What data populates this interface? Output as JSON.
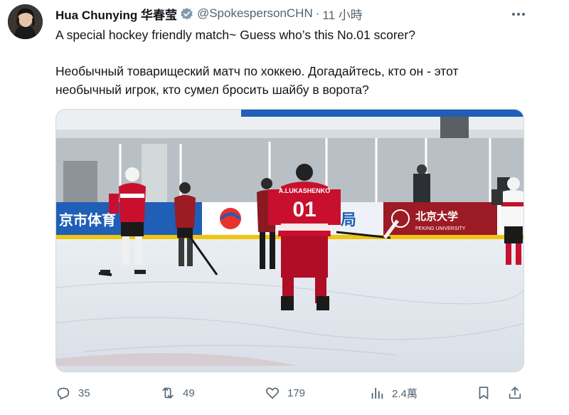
{
  "author": {
    "name": "Hua Chunying 华春莹",
    "handle": "@SpokespersonCHN",
    "separator": "·",
    "time": "11 小時",
    "verified_color": "#829aab"
  },
  "tweet": {
    "text_en": "A special hockey friendly match~ Guess who’s this No.01 scorer?",
    "text_ru_line1": "Необычный товарищеский матч по хоккею. Догадайтесь, кто он - этот",
    "text_ru_line2": "необычный игрок, кто сумел бросить шайбу в ворота?"
  },
  "media": {
    "jersey_name": "A.LUKASHENKO",
    "jersey_number": "01",
    "sign_left": "京市体育",
    "sign_right": "局",
    "sign_university_cn": "北京大学",
    "sign_university_en": "PEKING UNIVERSITY"
  },
  "actions": {
    "replies": "35",
    "reposts": "49",
    "likes": "179",
    "views": "2.4萬"
  },
  "colors": {
    "text_primary": "#0f1419",
    "text_secondary": "#536471",
    "jersey_red": "#c8102e",
    "board_blue": "#1f5fb6"
  }
}
